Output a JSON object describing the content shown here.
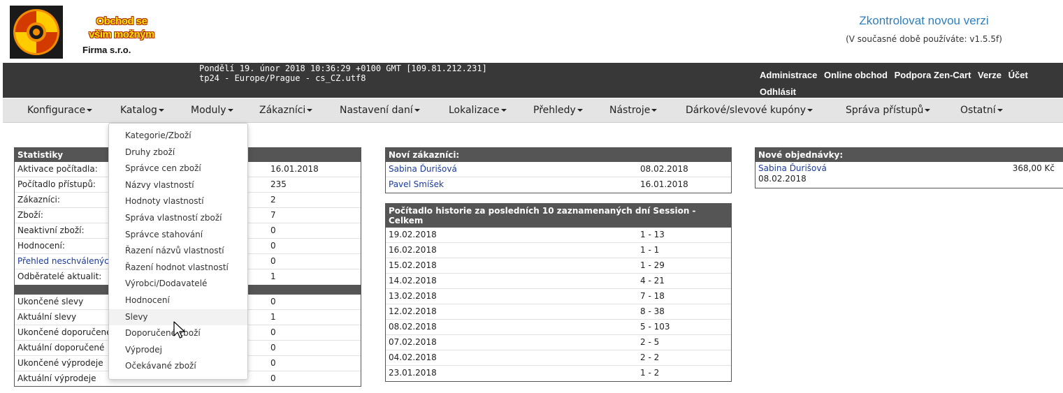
{
  "logo": {
    "line1": "Obchod se",
    "line2": "vším možným",
    "company": "Firma s.r.o."
  },
  "version": {
    "check_label": "Zkontrolovat novou verzi",
    "info": "(V současné době používáte: v1.5.5f)"
  },
  "topbar": {
    "datetime_line1": "Pondělí 19. únor 2018 10:36:29 +0100 GMT [109.81.212.231]",
    "datetime_line2": "tp24 - Europe/Prague - cs_CZ.utf8",
    "links": [
      "Administrace",
      "Online obchod",
      "Podpora Zen-Cart",
      "Verze",
      "Účet",
      "Odhlásit"
    ]
  },
  "menu": [
    "Konfigurace",
    "Katalog",
    "Moduly",
    "Zákazníci",
    "Nastavení daní",
    "Lokalizace",
    "Přehledy",
    "Nástroje",
    "Dárkové/slevové kupóny",
    "Správa přístupů",
    "Ostatní"
  ],
  "dropdown": {
    "items": [
      "Kategorie/Zboží",
      "Druhy zboží",
      "Správce cen zboží",
      "Názvy vlastností",
      "Hodnoty vlastností",
      "Správa vlastností zboží",
      "Správce stahování",
      "Řazení názvů vlastností",
      "Řazení hodnot vlastností",
      "Výrobci/Dodavatelé",
      "Hodnocení",
      "Slevy",
      "Doporučené zboží",
      "Výprodej",
      "Očekávané zboží"
    ],
    "hovered": "Slevy"
  },
  "stats": {
    "title": "Statistiky",
    "rows": [
      {
        "label": "Aktivace počítadla:",
        "value": "16.01.2018"
      },
      {
        "label": "Počítadlo přístupů:",
        "value": "235"
      },
      {
        "label": "Zákazníci:",
        "value": "2"
      },
      {
        "label": "Zboží:",
        "value": "7"
      },
      {
        "label": "Neaktivní zboží:",
        "value": "0"
      },
      {
        "label": "Hodnocení:",
        "value": "0"
      },
      {
        "label": "Přehled neschválených",
        "value": "0"
      },
      {
        "label": "Odběratelé aktualit:",
        "value": "1"
      }
    ],
    "rows2": [
      {
        "label": "Ukončené slevy",
        "value": "0"
      },
      {
        "label": "Aktuální slevy",
        "value": "1"
      },
      {
        "label": "Ukončené doporučené",
        "value": "0"
      },
      {
        "label": "Aktuální doporučené",
        "value": "0"
      },
      {
        "label": "Ukončené výprodeje",
        "value": "0"
      },
      {
        "label": "Aktuální výprodeje",
        "value": "0"
      }
    ]
  },
  "new_customers": {
    "title": "Noví zákazníci:",
    "rows": [
      {
        "name": "Sabina Ďurišová",
        "date": "08.02.2018"
      },
      {
        "name": "Pavel Smíšek",
        "date": "16.01.2018"
      }
    ]
  },
  "history": {
    "title": "Počítadlo historie za posledních 10 zaznamenaných dní   Session - Celkem",
    "rows": [
      {
        "date": "19.02.2018",
        "count": "1 - 13"
      },
      {
        "date": "16.02.2018",
        "count": "1 - 1"
      },
      {
        "date": "15.02.2018",
        "count": "1 - 29"
      },
      {
        "date": "14.02.2018",
        "count": "4 - 21"
      },
      {
        "date": "13.02.2018",
        "count": "7 - 18"
      },
      {
        "date": "12.02.2018",
        "count": "8 - 38"
      },
      {
        "date": "08.02.2018",
        "count": "5 - 103"
      },
      {
        "date": "07.02.2018",
        "count": "2 - 5"
      },
      {
        "date": "04.02.2018",
        "count": "2 - 2"
      },
      {
        "date": "23.01.2018",
        "count": "1 - 2"
      }
    ]
  },
  "new_orders": {
    "title": "Nové objednávky:",
    "rows": [
      {
        "name": "Sabina Ďurišová",
        "amount": "368,00 Kč",
        "date": "08.02.2018"
      }
    ]
  },
  "colors": {
    "header_bar": "#383838",
    "menu_bar": "#e4e4e4",
    "panel_head": "#555555",
    "link": "#1a3a9e",
    "version_link": "#2f7ec0"
  }
}
